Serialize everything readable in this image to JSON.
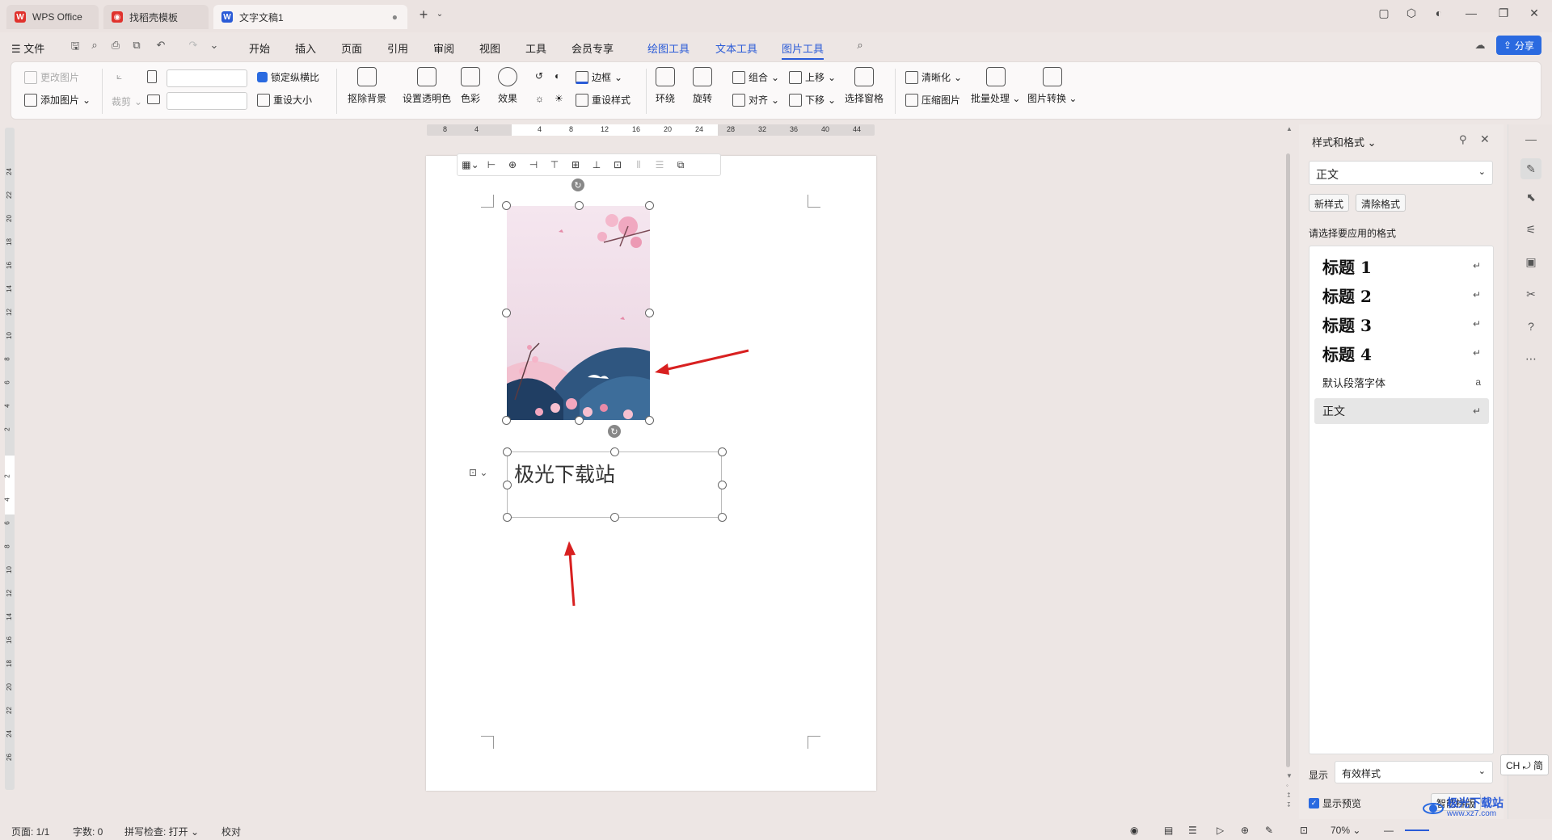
{
  "tabs": [
    {
      "label": "WPS Office",
      "icon": "wps-logo-icon",
      "color": "#e0322d"
    },
    {
      "label": "找稻壳模板",
      "icon": "daoke-icon",
      "color": "#e0322d"
    },
    {
      "label": "文字文稿1",
      "icon": "writer-doc-icon",
      "color": "#2a5bd7"
    }
  ],
  "menu": {
    "file": "文件",
    "items": [
      "开始",
      "插入",
      "页面",
      "引用",
      "审阅",
      "视图",
      "工具",
      "会员专享"
    ],
    "context_tabs": [
      "绘图工具",
      "文本工具",
      "图片工具"
    ],
    "share": "分享"
  },
  "ribbon": {
    "change_picture": "更改图片",
    "add_picture": "添加图片",
    "crop": "裁剪",
    "lock_aspect": "锁定纵横比",
    "reset_size": "重设大小",
    "remove_bg": "抠除背景",
    "set_transparent": "设置透明色",
    "color": "色彩",
    "effect": "效果",
    "border": "边框",
    "reset_style": "重设样式",
    "wrap": "环绕",
    "rotate": "旋转",
    "group": "组合",
    "align": "对齐",
    "bring_forward": "上移",
    "send_backward": "下移",
    "selection_pane": "选择窗格",
    "sharpen": "清晰化",
    "compress": "压缩图片",
    "batch": "批量处理",
    "convert": "图片转换"
  },
  "ruler": {
    "h_ticks": [
      "8",
      "4",
      "",
      "4",
      "8",
      "12",
      "16",
      "20",
      "24",
      "28",
      "32",
      "36",
      "40",
      "44"
    ],
    "v_ticks": [
      "24",
      "22",
      "20",
      "18",
      "16",
      "14",
      "12",
      "10",
      "8",
      "6",
      "4",
      "2",
      "",
      "2",
      "4",
      "6",
      "8",
      "10",
      "12",
      "14",
      "16",
      "18",
      "20",
      "22",
      "24",
      "26"
    ]
  },
  "document": {
    "textbox_text": "极光下载站"
  },
  "panel": {
    "title": "样式和格式",
    "current_style": "正文",
    "new_style": "新样式",
    "clear_format": "清除格式",
    "prompt": "请选择要应用的格式",
    "styles": [
      {
        "label": "标题  1",
        "kind": "heading",
        "mark": "↵"
      },
      {
        "label": "标题  2",
        "kind": "heading",
        "mark": "↵"
      },
      {
        "label": "标题  3",
        "kind": "heading",
        "mark": "↵"
      },
      {
        "label": "标题 4",
        "kind": "heading",
        "mark": "↵"
      },
      {
        "label": "默认段落字体",
        "kind": "plain",
        "mark": "a"
      },
      {
        "label": "正文",
        "kind": "plain",
        "mark": "↵"
      }
    ],
    "show_label": "显示",
    "show_value": "有效样式",
    "preview_label": "显示预览",
    "preview_checked": true,
    "smart_layout": "智能排版"
  },
  "ime": "CH ⤾ 简",
  "status": {
    "page": "页面: 1/1",
    "words": "字数: 0",
    "spell": "拼写检查: 打开",
    "proof": "校对",
    "zoom": "70%"
  },
  "watermark": "极光下载站",
  "watermark_url": "www.xz7.com"
}
